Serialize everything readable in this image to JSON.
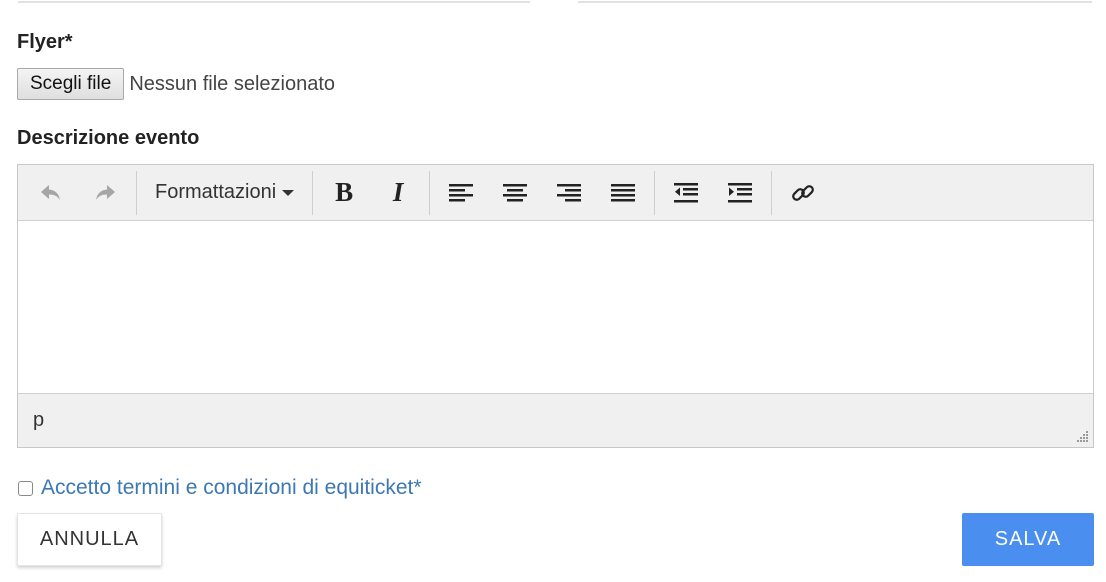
{
  "flyer": {
    "label": "Flyer*",
    "choose_button": "Scegli file",
    "status": "Nessun file selezionato"
  },
  "description": {
    "label": "Descrizione evento",
    "toolbar": {
      "undo_icon": "undo-icon",
      "redo_icon": "redo-icon",
      "formats_label": "Formattazioni",
      "bold_glyph": "B",
      "italic_glyph": "I",
      "align_icons": [
        "align-left-icon",
        "align-center-icon",
        "align-right-icon",
        "align-justify-icon"
      ],
      "indent_icons": [
        "outdent-icon",
        "indent-icon"
      ],
      "link_icon": "link-icon"
    },
    "statusbar_path": "p"
  },
  "terms": {
    "label": "Accetto termini e condizioni di equiticket*",
    "checked": false
  },
  "actions": {
    "cancel_label": "ANNULLA",
    "save_label": "SALVA"
  },
  "colors": {
    "save_button": "#4a8ef0",
    "terms_link": "#3d78b3",
    "toolbar_bg": "#f0f0f0"
  }
}
